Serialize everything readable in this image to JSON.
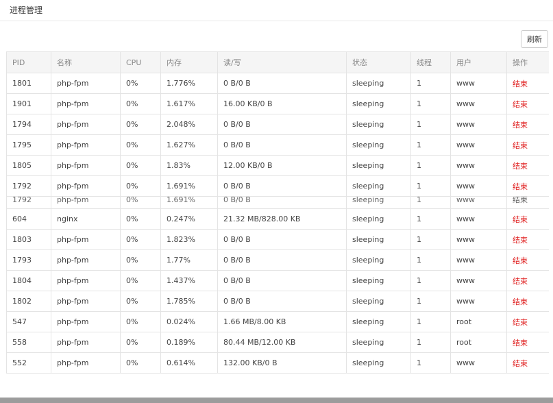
{
  "header": {
    "title": "进程管理"
  },
  "toolbar": {
    "refresh_label": "刷新"
  },
  "table": {
    "columns": [
      "PID",
      "名称",
      "CPU",
      "内存",
      "读/写",
      "状态",
      "线程",
      "用户",
      "操作"
    ],
    "rows": [
      [
        "1801",
        "php-fpm",
        "0%",
        "1.776%",
        "0 B/0 B",
        "sleeping",
        "1",
        "www",
        "结束"
      ],
      [
        "1901",
        "php-fpm",
        "0%",
        "1.617%",
        "16.00 KB/0 B",
        "sleeping",
        "1",
        "www",
        "结束"
      ],
      [
        "1794",
        "php-fpm",
        "0%",
        "2.048%",
        "0 B/0 B",
        "sleeping",
        "1",
        "www",
        "结束"
      ],
      [
        "1795",
        "php-fpm",
        "0%",
        "1.627%",
        "0 B/0 B",
        "sleeping",
        "1",
        "www",
        "结束"
      ],
      [
        "1805",
        "php-fpm",
        "0%",
        "1.83%",
        "12.00 KB/0 B",
        "sleeping",
        "1",
        "www",
        "结束"
      ],
      [
        "1792",
        "php-fpm",
        "0%",
        "1.691%",
        "0 B/0 B",
        "sleeping",
        "1",
        "www",
        "结束"
      ],
      [
        "1792",
        "php-fpm",
        "0%",
        "1.691%",
        "0 B/0 B",
        "sleeping",
        "1",
        "www",
        "结束"
      ],
      [
        "604",
        "nginx",
        "0%",
        "0.247%",
        "21.32 MB/828.00 KB",
        "sleeping",
        "1",
        "www",
        "结束"
      ],
      [
        "1803",
        "php-fpm",
        "0%",
        "1.823%",
        "0 B/0 B",
        "sleeping",
        "1",
        "www",
        "结束"
      ],
      [
        "1793",
        "php-fpm",
        "0%",
        "1.77%",
        "0 B/0 B",
        "sleeping",
        "1",
        "www",
        "结束"
      ],
      [
        "1804",
        "php-fpm",
        "0%",
        "1.437%",
        "0 B/0 B",
        "sleeping",
        "1",
        "www",
        "结束"
      ],
      [
        "1802",
        "php-fpm",
        "0%",
        "1.785%",
        "0 B/0 B",
        "sleeping",
        "1",
        "www",
        "结束"
      ],
      [
        "547",
        "php-fpm",
        "0%",
        "0.024%",
        "1.66 MB/8.00 KB",
        "sleeping",
        "1",
        "root",
        "结束"
      ],
      [
        "558",
        "php-fpm",
        "0%",
        "0.189%",
        "80.44 MB/12.00 KB",
        "sleeping",
        "1",
        "root",
        "结束"
      ],
      [
        "552",
        "php-fpm",
        "0%",
        "0.614%",
        "132.00 KB/0 B",
        "sleeping",
        "1",
        "www",
        "结束"
      ]
    ]
  }
}
